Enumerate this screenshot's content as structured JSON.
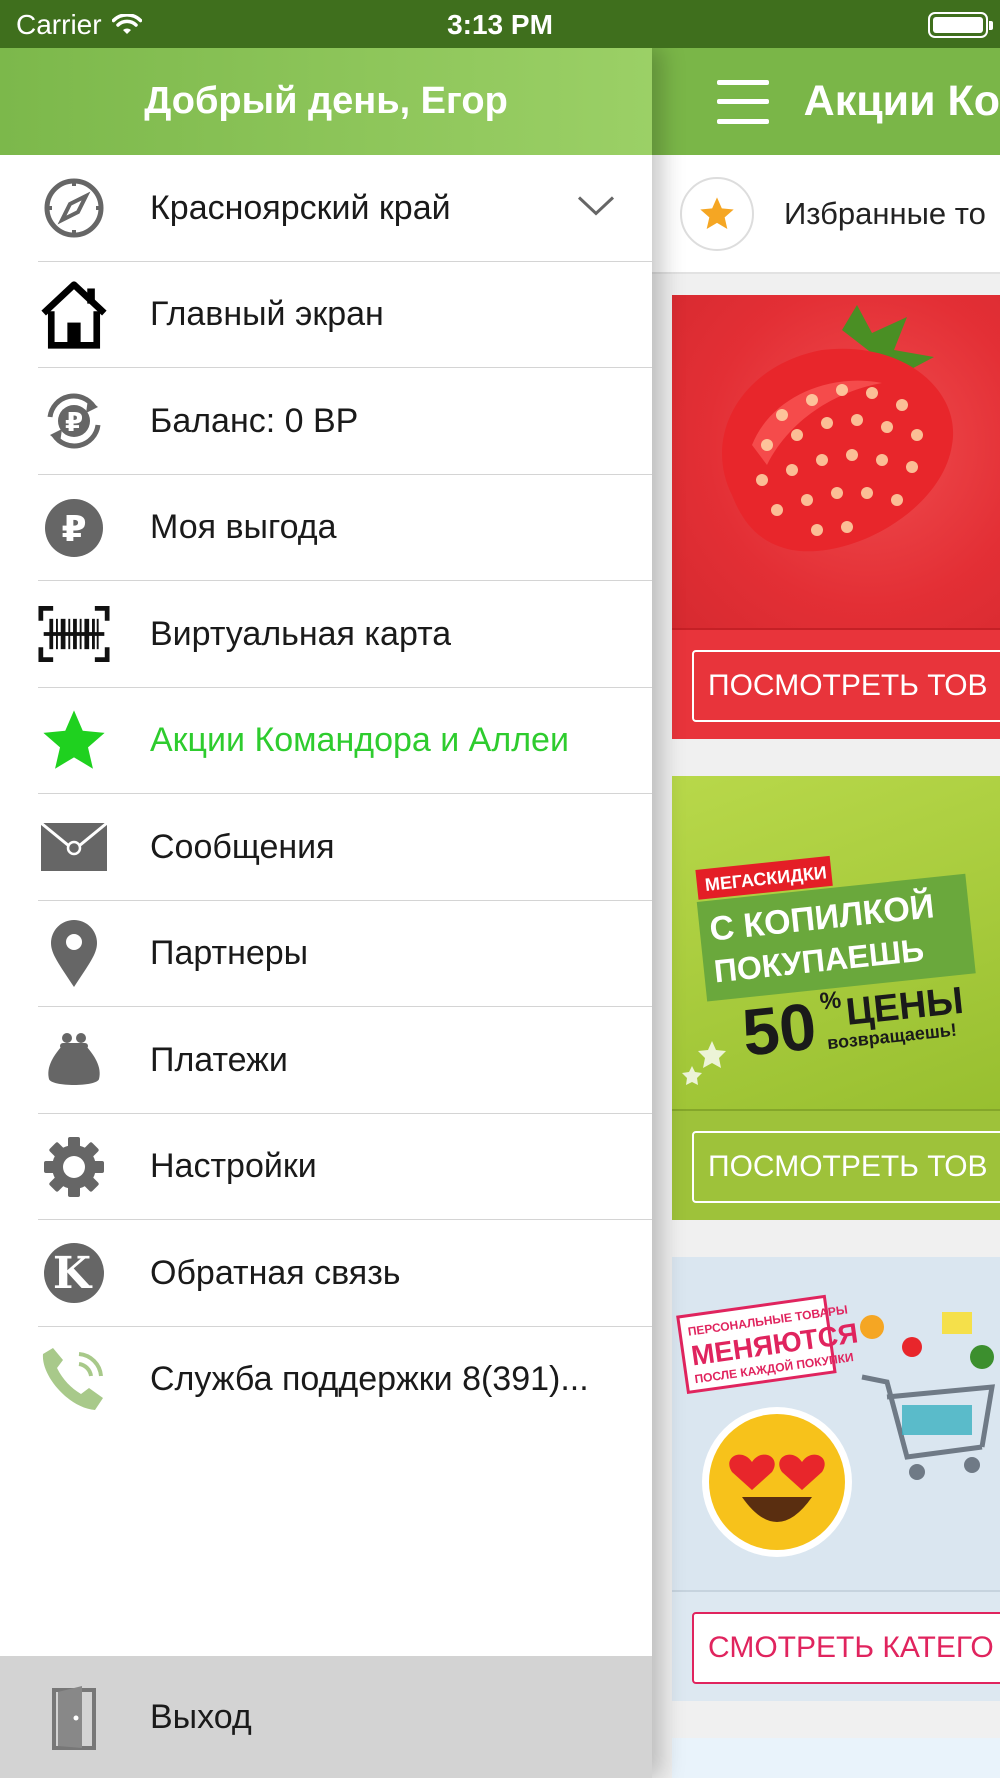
{
  "status_bar": {
    "carrier": "Carrier",
    "time": "3:13 PM"
  },
  "drawer": {
    "greeting": "Добрый день, Егор",
    "items": [
      {
        "label": "Красноярский край",
        "icon": "compass-icon"
      },
      {
        "label": "Главный экран",
        "icon": "home-icon"
      },
      {
        "label": "Баланс: 0 ВР",
        "icon": "ruble-exchange-icon"
      },
      {
        "label": "Моя выгода",
        "icon": "ruble-icon"
      },
      {
        "label": "Виртуальная карта",
        "icon": "barcode-icon"
      },
      {
        "label": "Акции Командора и Аллеи",
        "icon": "star-icon",
        "active": true
      },
      {
        "label": "Сообщения",
        "icon": "envelope-icon"
      },
      {
        "label": "Партнеры",
        "icon": "map-pin-icon"
      },
      {
        "label": "Платежи",
        "icon": "wallet-icon"
      },
      {
        "label": "Настройки",
        "icon": "gear-icon"
      },
      {
        "label": "Обратная связь",
        "icon": "k-logo-icon"
      },
      {
        "label": "Служба поддержки 8(391)...",
        "icon": "phone-icon"
      }
    ],
    "logout_label": "Выход"
  },
  "main": {
    "title": "Акции Ко",
    "favorites_label": "Избранные то",
    "cards": [
      {
        "button_label": "ПОСМОТРЕТЬ ТОВ",
        "image_text": []
      },
      {
        "button_label": "ПОСМОТРЕТЬ ТОВ",
        "image_text": [
          "МЕГАСКИДКИ",
          "С КОПИЛКОЙ",
          "ПОКУПАЕШЬ",
          "50",
          "%",
          "ЦЕНЫ",
          "возвращаешь!"
        ]
      },
      {
        "button_label": "СМОТРЕТЬ КАТЕГО",
        "image_text": [
          "ПЕРСОНАЛЬНЫЕ ТОВАРЫ",
          "МЕНЯЮТСЯ",
          "ПОСЛЕ КАЖДОЙ ПОКУПКИ"
        ]
      }
    ]
  },
  "colors": {
    "status_bar": "#3f6f1d",
    "header_green": "#7ab648",
    "active_item": "#2ecc2e",
    "icon_gray": "#666666",
    "logout_bg": "#d3d3d3",
    "favorite_star": "#f5a623"
  }
}
